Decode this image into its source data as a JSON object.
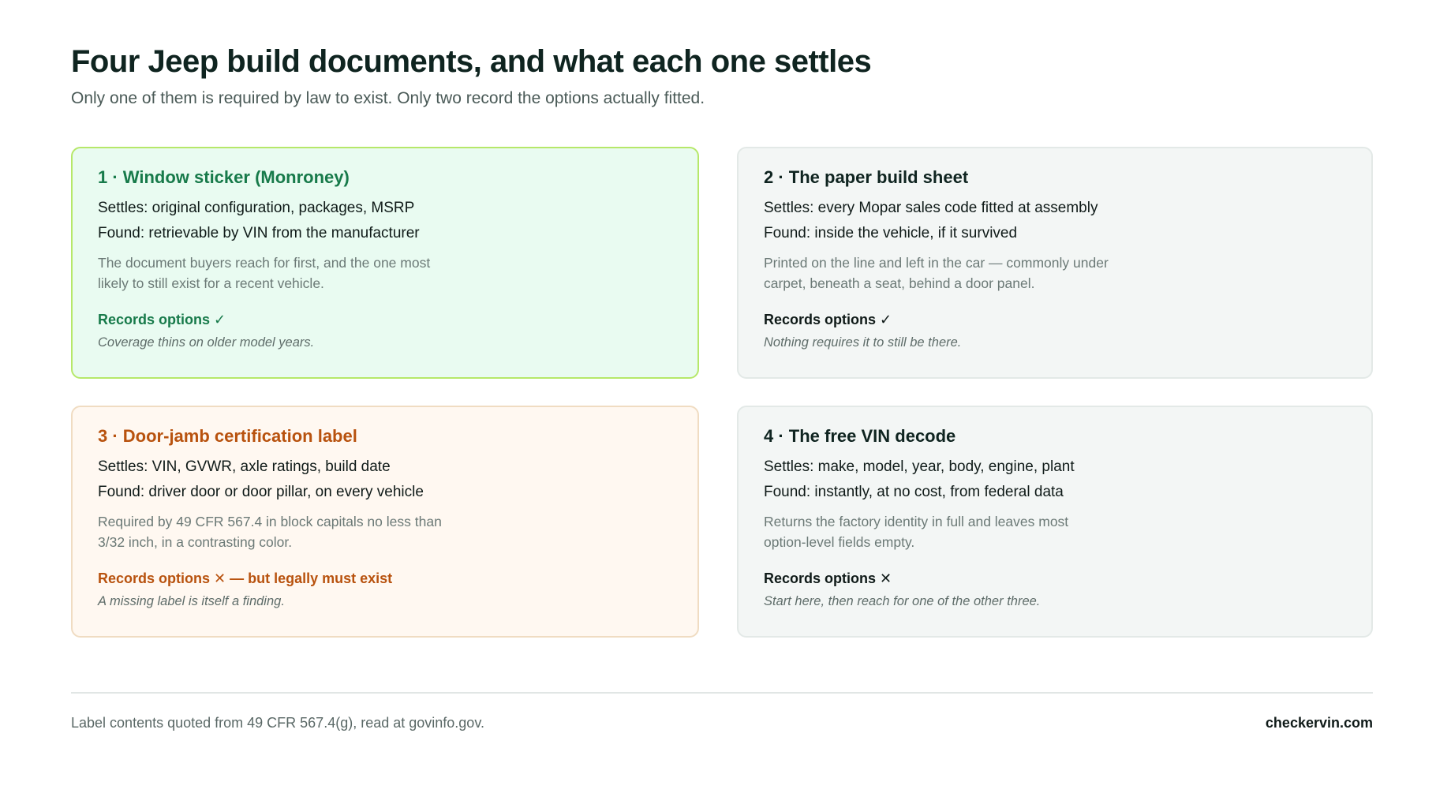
{
  "header": {
    "title": "Four Jeep build documents, and what each one settles",
    "subtitle": "Only one of them is required by law to exist. Only two record the options actually fitted."
  },
  "cards": [
    {
      "title": "1 · Window sticker (Monroney)",
      "settles": "Settles: original configuration, packages, MSRP",
      "found": "Found: retrievable by VIN from the manufacturer",
      "description": "The document buyers reach for first, and the one most likely to still exist for a recent vehicle.",
      "records": "Records options ✓",
      "note": "Coverage thins on older model years.",
      "accent": "#177a4a"
    },
    {
      "title": "2 · The paper build sheet",
      "settles": "Settles: every Mopar sales code fitted at assembly",
      "found": "Found: inside the vehicle, if it survived",
      "description": "Printed on the line and left in the car — commonly under carpet, beneath a seat, behind a door panel.",
      "records": "Records options ✓",
      "note": "Nothing requires it to still be there.",
      "accent": "#0f2420"
    },
    {
      "title": "3 · Door-jamb certification label",
      "settles": "Settles: VIN, GVWR, axle ratings, build date",
      "found": "Found: driver door or door pillar, on every vehicle",
      "description": "Required by 49 CFR 567.4 in block capitals no less than 3/32 inch, in a contrasting color.",
      "records": "Records options ✕ — but legally must exist",
      "note": "A missing label is itself a finding.",
      "accent": "#b8520e"
    },
    {
      "title": "4 · The free VIN decode",
      "settles": "Settles: make, model, year, body, engine, plant",
      "found": "Found: instantly, at no cost, from federal data",
      "description": "Returns the factory identity in full and leaves most option-level fields empty.",
      "records": "Records options ✕",
      "note": "Start here, then reach for one of the other three.",
      "accent": "#0f2420"
    }
  ],
  "footer": {
    "source": "Label contents quoted from 49 CFR 567.4(g), read at govinfo.gov.",
    "brand": "checkervin.com"
  }
}
